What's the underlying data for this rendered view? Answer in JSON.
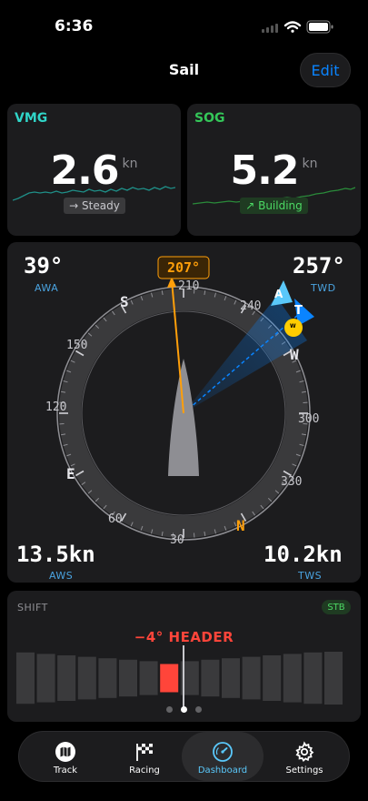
{
  "status": {
    "time": "6:36"
  },
  "header": {
    "title": "Sail",
    "edit_label": "Edit"
  },
  "vmg": {
    "title": "VMG",
    "value": "2.6",
    "unit": "kn",
    "trend": "→ Steady",
    "color": "#30d5c8"
  },
  "sog": {
    "title": "SOG",
    "value": "5.2",
    "unit": "kn",
    "trend": "↗ Building",
    "color": "#34c759"
  },
  "compass": {
    "awa": {
      "value": "39°",
      "label": "AWA"
    },
    "twd": {
      "value": "257°",
      "label": "TWD"
    },
    "aws": {
      "value": "13.5kn",
      "label": "AWS"
    },
    "tws": {
      "value": "10.2kn",
      "label": "TWS"
    },
    "heading_label": "207°",
    "heading_deg": 207,
    "ring_labels": {
      "s": "S",
      "w": "W",
      "e": "E",
      "n": "N",
      "210": "210",
      "240": "240",
      "300": "300",
      "330": "330",
      "30": "30",
      "60": "60",
      "120": "120",
      "150": "150"
    },
    "apparent_marker": "A",
    "true_marker": "T",
    "wind_marker": "W",
    "colors": {
      "heading": "#ff9f0a",
      "north": "#ff9f0a",
      "wind": "#0a84ff",
      "marker": "#ffcc00"
    }
  },
  "shift": {
    "label": "SHIFT",
    "tack": "STB",
    "value": "−4°  HEADER",
    "current_index": 7,
    "bar_count": 16,
    "color": "#ff453a"
  },
  "pager": {
    "count": 3,
    "active": 1
  },
  "tabs": [
    {
      "label": "Track",
      "icon": "map-icon",
      "active": false
    },
    {
      "label": "Racing",
      "icon": "checkered-flag-icon",
      "active": false
    },
    {
      "label": "Dashboard",
      "icon": "gauge-icon",
      "active": true
    },
    {
      "label": "Settings",
      "icon": "gear-icon",
      "active": false
    }
  ]
}
